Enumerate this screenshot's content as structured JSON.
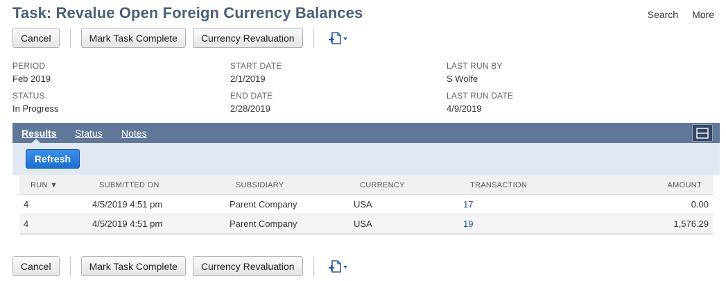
{
  "header": {
    "title": "Task: Revalue Open Foreign Currency Balances",
    "links": {
      "search": "Search",
      "more": "More"
    }
  },
  "toolbar": {
    "cancel": "Cancel",
    "mark_complete": "Mark Task Complete",
    "currency_revaluation": "Currency Revaluation",
    "new_icon": "new-document-icon"
  },
  "fields": {
    "period": {
      "label": "PERIOD",
      "value": "Feb 2019"
    },
    "status": {
      "label": "STATUS",
      "value": "In Progress"
    },
    "start_date": {
      "label": "START DATE",
      "value": "2/1/2019"
    },
    "end_date": {
      "label": "END DATE",
      "value": "2/28/2019"
    },
    "last_run_by": {
      "label": "LAST RUN BY",
      "value": "S Wolfe"
    },
    "last_run_date": {
      "label": "LAST RUN DATE",
      "value": "4/9/2019"
    }
  },
  "tabs": {
    "results": "Results",
    "status": "Status",
    "notes": "Notes",
    "active": "Results"
  },
  "results": {
    "refresh": "Refresh",
    "columns": {
      "run": "RUN",
      "sort_indicator": "▼",
      "submitted_on": "SUBMITTED ON",
      "subsidiary": "SUBSIDIARY",
      "currency": "CURRENCY",
      "transaction": "TRANSACTION",
      "amount": "AMOUNT"
    },
    "rows": [
      {
        "run": "4",
        "submitted_on": "4/5/2019 4:51 pm",
        "subsidiary": "Parent Company",
        "currency": "USA",
        "transaction": "17",
        "amount": "0.00"
      },
      {
        "run": "4",
        "submitted_on": "4/5/2019 4:51 pm",
        "subsidiary": "Parent Company",
        "currency": "USA",
        "transaction": "19",
        "amount": "1,576.29"
      }
    ]
  },
  "colors": {
    "title": "#4d5f79",
    "tabbar": "#607799",
    "subpanel": "#e1e8f1",
    "primary_button": "#1b6fd0",
    "link": "#255599"
  }
}
